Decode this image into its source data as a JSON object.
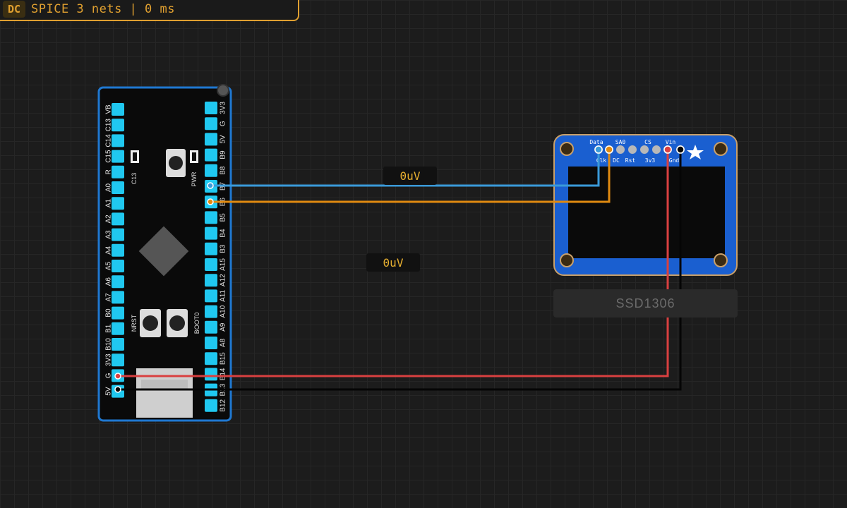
{
  "status_bar": {
    "badge": "DC",
    "text": "SPICE 3 nets | 0 ms"
  },
  "probes": [
    {
      "value": "0uV"
    },
    {
      "value": "0uV"
    }
  ],
  "mcu": {
    "left_pins": [
      "VB",
      "C13",
      "C14",
      "C15",
      "R",
      "A0",
      "A1",
      "A2",
      "A3",
      "A4",
      "A5",
      "A6",
      "A7",
      "B0",
      "B1",
      "B10",
      "3V3",
      "G",
      "5V"
    ],
    "right_pins": [
      "3V3",
      "G",
      "5V",
      "B9",
      "B8",
      "B7",
      "B6",
      "B5",
      "B4",
      "B3",
      "A15",
      "A12",
      "A11",
      "A10",
      "A9",
      "A8",
      "B15",
      "B14",
      "B13",
      "B12"
    ],
    "led_labels": [
      "C13",
      "PWR"
    ],
    "button_labels": [
      "NRST",
      "BOOT0"
    ]
  },
  "oled": {
    "name": "SSD1306",
    "top_labels": [
      "Data",
      "SA0",
      "CS",
      "Vin"
    ],
    "bottom_labels": [
      "Clk",
      "DC",
      "Rst",
      "3v3",
      "Gnd"
    ]
  },
  "colors": {
    "accent": "#e0a030",
    "wire_blue": "#3a9ad9",
    "wire_orange": "#e08a10",
    "wire_red": "#d94040",
    "wire_black": "#050505",
    "board_blue": "#1464c8",
    "pin_cyan": "#20c8f0"
  }
}
